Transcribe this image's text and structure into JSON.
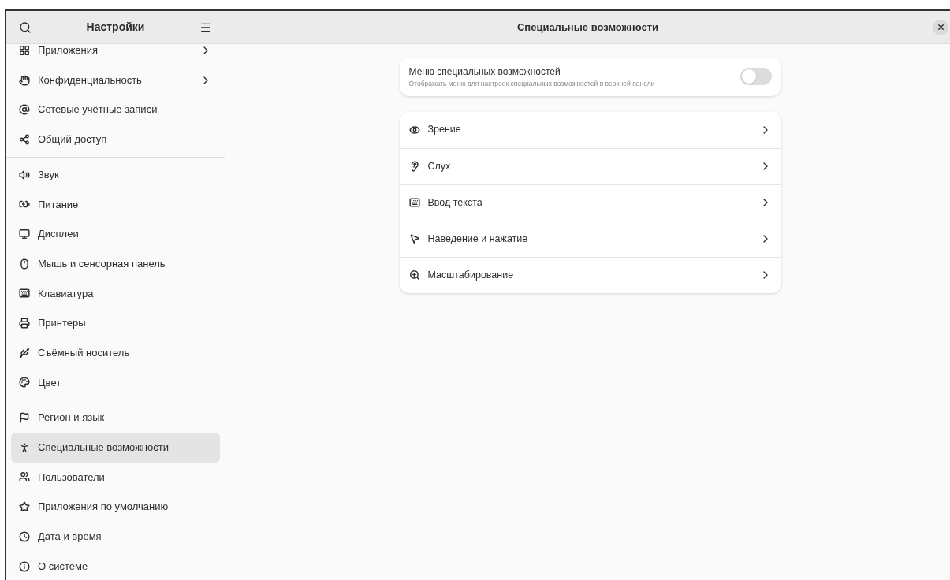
{
  "sidebar": {
    "title": "Настройки",
    "groups": [
      {
        "items": [
          {
            "label": "Приложения",
            "arrow": true,
            "selected": false
          },
          {
            "label": "Конфиденциальность",
            "arrow": true,
            "selected": false
          },
          {
            "label": "Сетевые учётные записи",
            "arrow": false,
            "selected": false
          },
          {
            "label": "Общий доступ",
            "arrow": false,
            "selected": false
          }
        ]
      },
      {
        "items": [
          {
            "label": "Звук",
            "arrow": false,
            "selected": false
          },
          {
            "label": "Питание",
            "arrow": false,
            "selected": false
          },
          {
            "label": "Дисплеи",
            "arrow": false,
            "selected": false
          },
          {
            "label": "Мышь и сенсорная панель",
            "arrow": false,
            "selected": false
          },
          {
            "label": "Клавиатура",
            "arrow": false,
            "selected": false
          },
          {
            "label": "Принтеры",
            "arrow": false,
            "selected": false
          },
          {
            "label": "Съёмный носитель",
            "arrow": false,
            "selected": false
          },
          {
            "label": "Цвет",
            "arrow": false,
            "selected": false
          }
        ]
      },
      {
        "items": [
          {
            "label": "Регион и язык",
            "arrow": false,
            "selected": false
          },
          {
            "label": "Специальные возможности",
            "arrow": false,
            "selected": true
          },
          {
            "label": "Пользователи",
            "arrow": false,
            "selected": false
          },
          {
            "label": "Приложения по умолчанию",
            "arrow": false,
            "selected": false
          },
          {
            "label": "Дата и время",
            "arrow": false,
            "selected": false
          },
          {
            "label": "О системе",
            "arrow": false,
            "selected": false
          }
        ]
      }
    ]
  },
  "page": {
    "title": "Специальные возможности",
    "menu_setting": {
      "title": "Меню специальных возможностей",
      "subtitle": "Отображать меню для настроек специальных возможностей в верхней панели",
      "on": false
    },
    "rows": [
      {
        "label": "Зрение"
      },
      {
        "label": "Слух"
      },
      {
        "label": "Ввод текста"
      },
      {
        "label": "Наведение и нажатие"
      },
      {
        "label": "Масштабирование"
      }
    ]
  }
}
